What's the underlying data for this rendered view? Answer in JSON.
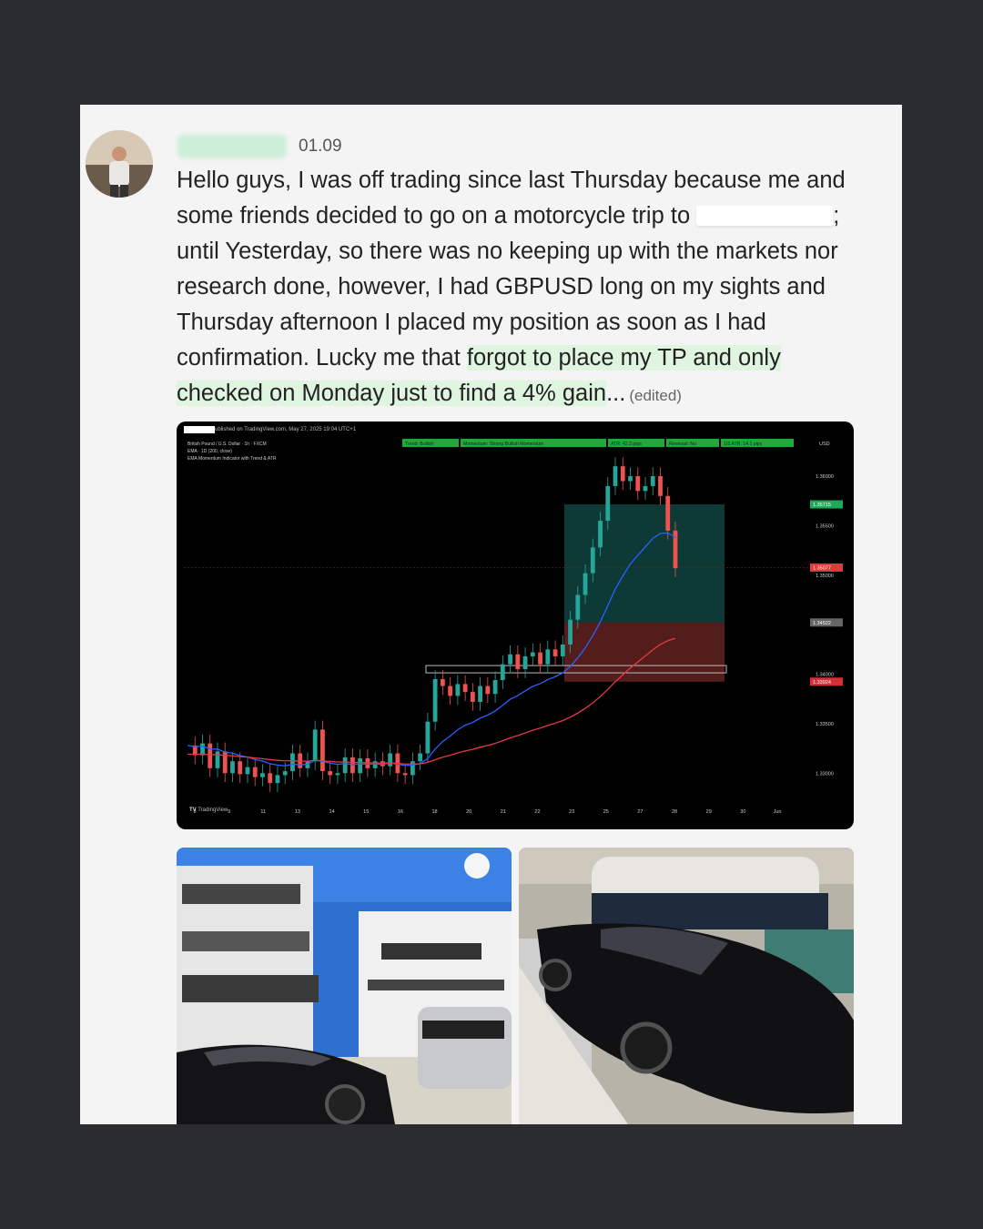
{
  "message": {
    "timestamp": "01.09",
    "text_line1": "Hello guys, I was off trading since last Thursday because me and some friends decided to go on a motorcycle trip to ",
    "text_line2": "; until Yesterday, so there was no keeping up with the markets nor research done, however, I had GBPUSD long on my sights and Thursday afternoon I placed my position as soon as I had confirmation. Lucky me that ",
    "highlighted": "forgot to place my TP and only checked on Monday just to find a 4% gain",
    "ellipsis": "...",
    "edited": "(edited)"
  },
  "chart": {
    "header": "ublished on TradingView.com, May 27, 2025 19:04 UTC+1",
    "legend_lines": [
      "British Pound / U.S. Dollar · 1h · FXCM",
      "EMA · 1D (200, close)",
      "EMA Momentum Indicator with Trend & ATR"
    ],
    "status_chips": [
      "Trend: Bullish",
      "Momentum: Strong Bullish Momentum",
      "ATR: 42.3 pips",
      "Reversal: No",
      "1/3 ATR: 14.1 pips"
    ],
    "currency": "USD",
    "price_axis": [
      "1.36000",
      "1.35500",
      "1.35000",
      "1.34500",
      "1.34000",
      "1.33500",
      "1.33000"
    ],
    "price_tags": {
      "target": "1.35715",
      "current": "1.35077",
      "stop": "1.33924",
      "entry": "1.34522"
    },
    "date_axis": [
      "8",
      "9",
      "11",
      "13",
      "14",
      "15",
      "16",
      "18",
      "20",
      "21",
      "22",
      "23",
      "25",
      "27",
      "28",
      "29",
      "30",
      "Jun"
    ],
    "footer": "TradingView",
    "colors": {
      "up": "#26a69a",
      "down": "#ef5350",
      "ema_blue": "#2962ff",
      "ema_red": "#e53945",
      "chip": "#1faa3c"
    }
  },
  "photos": [
    {
      "name": "yachts-and-supercar"
    },
    {
      "name": "black-supercar-marina"
    }
  ]
}
